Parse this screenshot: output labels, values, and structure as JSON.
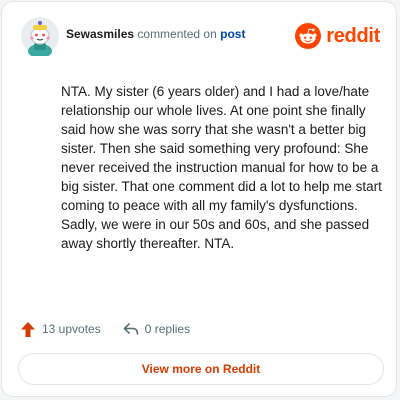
{
  "comment": {
    "username": "Sewasmiles",
    "action_text": "commented on",
    "post_link_label": "post",
    "body": "NTA. My sister (6 years older) and I had a love/hate relationship our whole lives. At one point she finally said how she was sorry that she wasn't a better big sister. Then she said something very profound: She never received the instruction manual for how to be a big sister. That one comment did a lot to help me start coming to peace with all my family's dysfunctions. Sadly, we were in our 50s and 60s, and she passed away shortly thereafter. NTA."
  },
  "brand": {
    "wordmark": "reddit",
    "icon": "reddit-snoo-icon",
    "color": "#ff4500"
  },
  "actions": {
    "upvotes_label": "13 upvotes",
    "upvote_icon": "upvote-arrow-icon",
    "upvote_color": "#d93a00",
    "replies_label": "0 replies",
    "reply_icon": "reply-arrow-icon"
  },
  "footer": {
    "view_more_label": "View more on Reddit"
  }
}
